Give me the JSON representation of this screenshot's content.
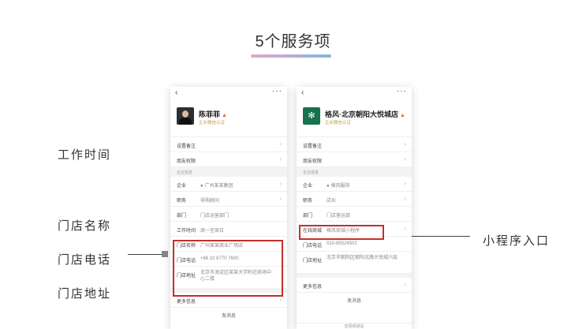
{
  "title": "5个服务项",
  "left_labels": [
    "工作时间",
    "门店名称",
    "门店电话",
    "门店地址"
  ],
  "right_label": "小程序入口",
  "phone_a": {
    "name": "陈菲菲",
    "flag": "▲",
    "subtitle": "企业微信认证",
    "rows_top": [
      {
        "k": "设置备注",
        "v": ""
      },
      {
        "k": "朋友权限",
        "v": ""
      }
    ],
    "section_title": "企业信息",
    "rows_mid": [
      {
        "k": "企业",
        "v": "广州某某集团"
      },
      {
        "k": "职务",
        "v": "导购顾问"
      },
      {
        "k": "部门",
        "v": "门店运营部门"
      },
      {
        "k": "工作时间",
        "v": "周一至周日"
      }
    ],
    "rows_hl": [
      {
        "k": "门店名称",
        "v": "广州某某商业广场店"
      },
      {
        "k": "门店电话",
        "v": "+86 10 6770 7600"
      },
      {
        "k": "门店地址",
        "v": "北京市海淀区某某大学附近商场中心二楼"
      }
    ],
    "more": "更多信息",
    "footer": "发消息"
  },
  "phone_b": {
    "name": "格风·北京朝阳大悦城店",
    "flag": "▲",
    "subtitle": "企业微信认证",
    "rows_top": [
      {
        "k": "设置备注",
        "v": ""
      },
      {
        "k": "朋友权限",
        "v": ""
      }
    ],
    "section_title": "企业信息",
    "rows_mid": [
      {
        "k": "企业",
        "v": "格风服饰"
      },
      {
        "k": "职务",
        "v": "店长"
      },
      {
        "k": "部门",
        "v": "门店营运部"
      }
    ],
    "rows_hl": [
      {
        "k": "在线商城",
        "v": "格风商城小程序"
      }
    ],
    "rows_bottom": [
      {
        "k": "门店电话",
        "v": "010-85524502"
      },
      {
        "k": "门店地址",
        "v": "北京市朝阳区朝阳北路大悦城六层"
      }
    ],
    "more": "更多信息",
    "footer": "发消息",
    "tab": "音视频通话"
  },
  "icons": {
    "back": "‹",
    "more": "···",
    "arrow": "›",
    "shield": "●",
    "logo": "✻"
  }
}
